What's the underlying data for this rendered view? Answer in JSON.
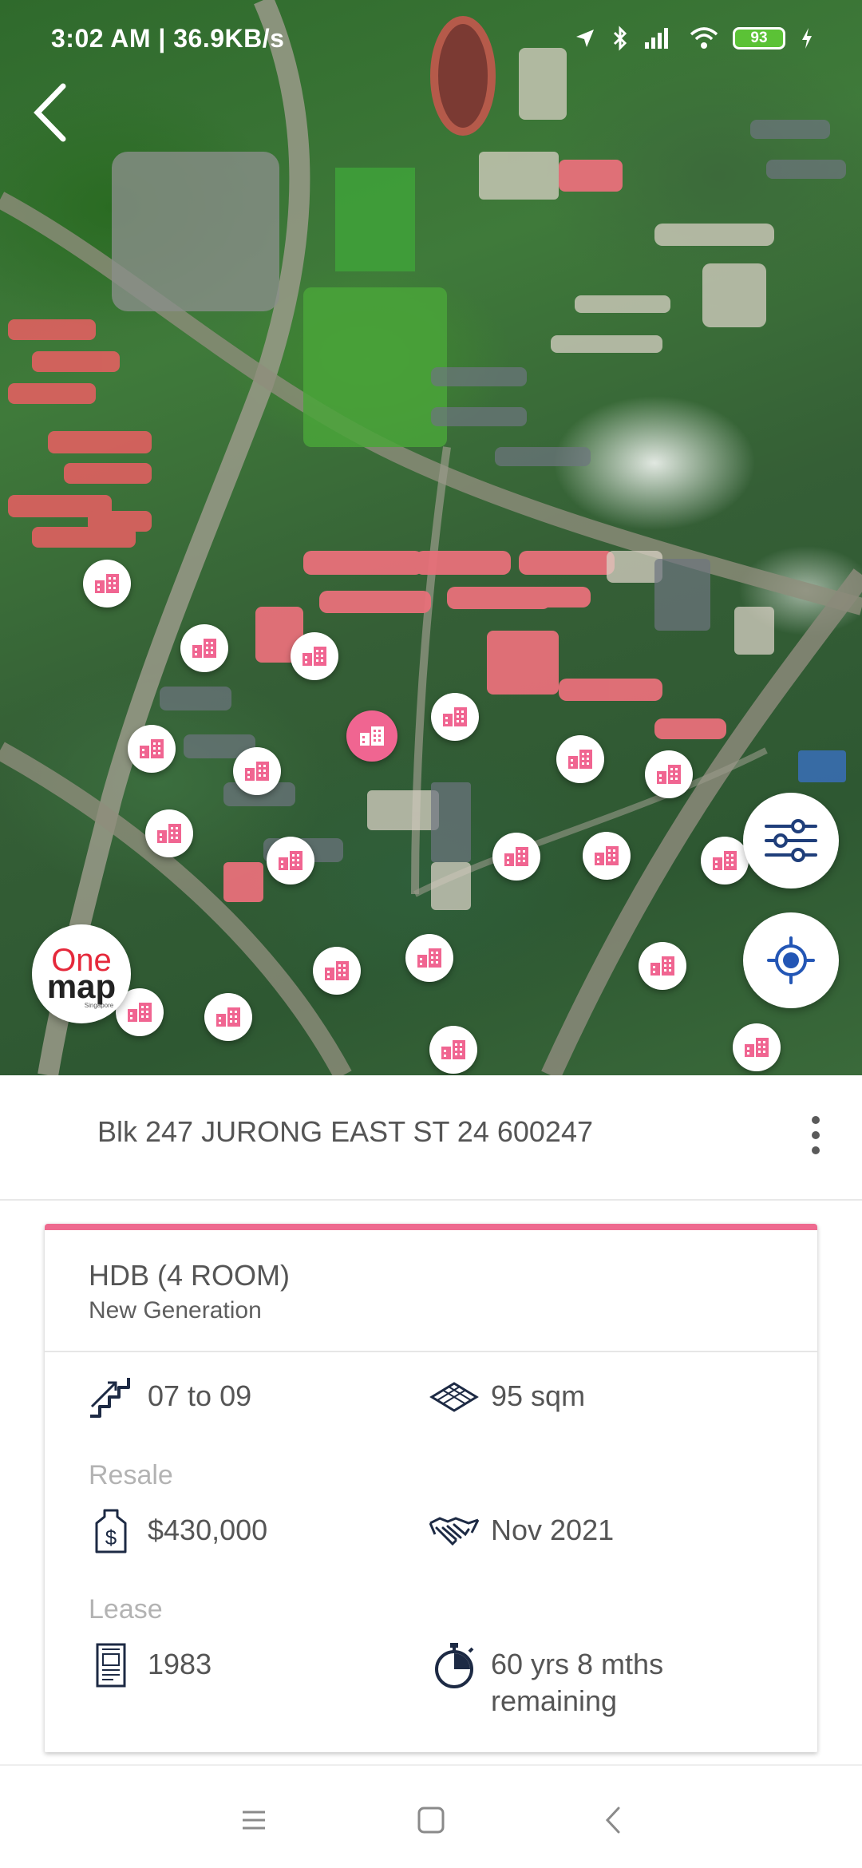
{
  "status_bar": {
    "time_speed": "3:02 AM | 36.9KB/s",
    "battery": "93"
  },
  "map": {
    "logo_text_top": "One",
    "logo_text_bottom": "map",
    "logo_text_small": "Singapore"
  },
  "address": {
    "text": "Blk 247 JURONG EAST ST 24 600247"
  },
  "card": {
    "accent_color": "#ee6a8f",
    "title": "HDB (4 ROOM)",
    "subtitle": "New Generation",
    "floor_range": "07 to 09",
    "floor_area": "95 sqm",
    "resale_label": "Resale",
    "price": "$430,000",
    "transaction_date": "Nov 2021",
    "lease_label": "Lease",
    "lease_start": "1983",
    "lease_remaining": "60 yrs 8 mths remaining"
  },
  "icons": {
    "back": "back-arrow-icon",
    "filter": "filter-sliders-icon",
    "locate": "gps-locate-icon",
    "more": "more-vertical-icon",
    "stairs": "stairs-icon",
    "area": "floor-grid-icon",
    "price": "price-tag-icon",
    "handshake": "handshake-icon",
    "document": "document-icon",
    "stopwatch": "stopwatch-icon"
  }
}
